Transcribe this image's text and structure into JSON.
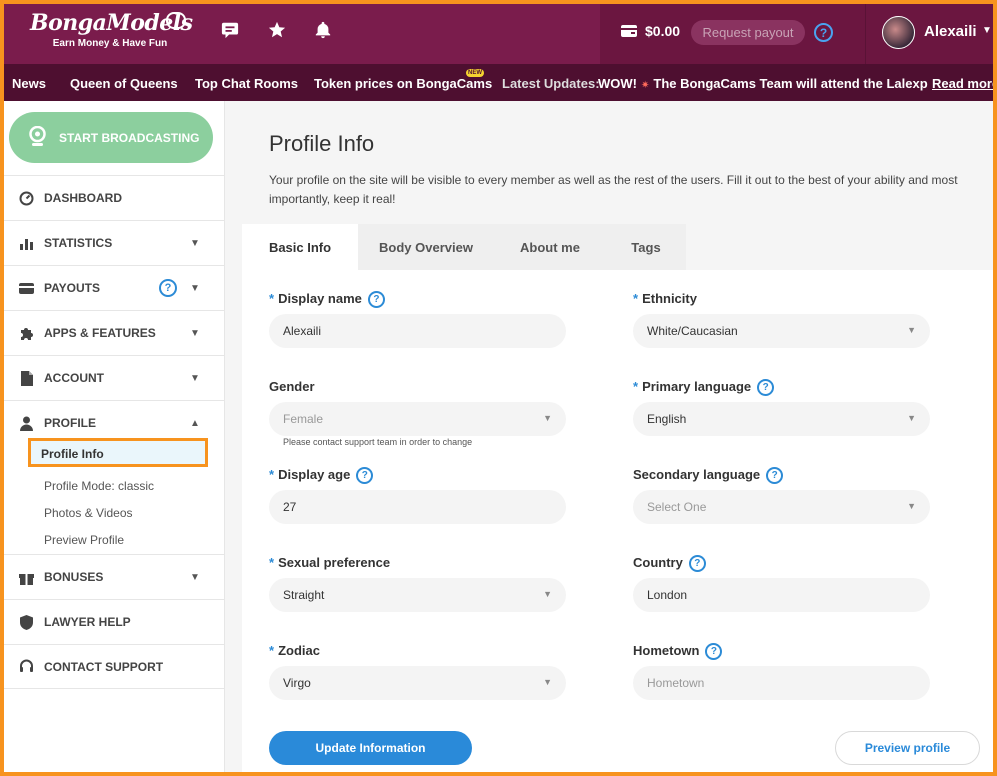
{
  "header": {
    "logo_brand": "BongaModels",
    "logo_tagline": "Earn Money & Have Fun",
    "balance": "$0.00",
    "request_payout": "Request payout",
    "help": "?",
    "username": "Alexaili"
  },
  "newsbar": {
    "links": [
      "News",
      "Queen of Queens",
      "Top Chat Rooms",
      "Token prices on BongaCams"
    ],
    "new_badge": "NEW",
    "latest_label": "Latest Updates:",
    "ticker_prefix": "WOW!",
    "ticker_text": "The BongaCams Team will attend the Lalexpo La",
    "read_more": "Read more"
  },
  "sidebar": {
    "start_broadcasting": "START BROADCASTING",
    "items": [
      {
        "label": "DASHBOARD",
        "icon": "gauge-icon"
      },
      {
        "label": "STATISTICS",
        "icon": "bar-chart-icon"
      },
      {
        "label": "PAYOUTS",
        "icon": "wallet-icon"
      },
      {
        "label": "APPS & FEATURES",
        "icon": "puzzle-icon"
      },
      {
        "label": "ACCOUNT",
        "icon": "document-icon"
      },
      {
        "label": "PROFILE",
        "icon": "user-icon"
      },
      {
        "label": "BONUSES",
        "icon": "gift-icon"
      },
      {
        "label": "LAWYER HELP",
        "icon": "shield-icon"
      },
      {
        "label": "CONTACT SUPPORT",
        "icon": "headset-icon"
      }
    ],
    "profile_sub": [
      "Profile Info",
      "Profile Mode: classic",
      "Photos & Videos",
      "Preview Profile"
    ]
  },
  "main": {
    "title": "Profile Info",
    "intro": "Your profile on the site will be visible to every member as well as the rest of the users. Fill it out to the best of your ability and most importantly, keep it real!",
    "tabs": [
      "Basic Info",
      "Body Overview",
      "About me",
      "Tags"
    ],
    "fields": {
      "display_name": {
        "label": "Display name",
        "value": "Alexaili"
      },
      "ethnicity": {
        "label": "Ethnicity",
        "value": "White/Caucasian"
      },
      "gender": {
        "label": "Gender",
        "value": "Female",
        "note": "Please contact support team in order to change"
      },
      "primary_language": {
        "label": "Primary language",
        "value": "English"
      },
      "display_age": {
        "label": "Display age",
        "value": "27"
      },
      "secondary_language": {
        "label": "Secondary language",
        "placeholder": "Select One"
      },
      "sexual_preference": {
        "label": "Sexual preference",
        "value": "Straight"
      },
      "country": {
        "label": "Country",
        "value": "London"
      },
      "zodiac": {
        "label": "Zodiac",
        "value": "Virgo"
      },
      "hometown": {
        "label": "Hometown",
        "placeholder": "Hometown"
      }
    },
    "required_mark": "*",
    "update_button": "Update Information",
    "preview_button": "Preview profile"
  },
  "colors": {
    "brand": "#7a1c4c",
    "news_bg": "#4e0f30",
    "accent_blue": "#2a8ad9",
    "start_green": "#8ccf9e",
    "highlight_orange": "#f7931e"
  }
}
